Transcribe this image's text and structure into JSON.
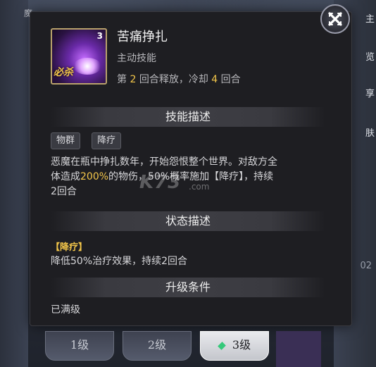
{
  "skill": {
    "name": "苦痛挣扎",
    "type": "主动技能",
    "level_badge": "3",
    "ult_label": "必杀",
    "timing_prefix": "第 ",
    "release_round": "2",
    "timing_mid": " 回合释放，冷却 ",
    "cooldown": "4",
    "timing_suffix": " 回合"
  },
  "sections": {
    "skill_desc_title": "技能描述",
    "status_desc_title": "状态描述",
    "upgrade_title": "升级条件"
  },
  "tags": [
    "物群",
    "降疗"
  ],
  "description": {
    "line1": "恶魔在瓶中挣扎数年，开始怨恨整个世界。对敌方全",
    "line2_a": "体造成",
    "line2_hl": "200%",
    "line2_b": "的物伤，50%概率施加【降疗】，持续",
    "line3": "2回合"
  },
  "status": {
    "name": "【降疗】",
    "text": "降低50%治疗效果，持续2回合"
  },
  "upgrade": {
    "text": "已满级"
  },
  "level_tabs": [
    "1级",
    "2级",
    "3级"
  ],
  "watermark": {
    "main": "K73",
    "sub": ".com"
  },
  "background": {
    "left_label": "魔",
    "right_items": [
      "主",
      "览",
      "享",
      "肤"
    ],
    "right_number": "02"
  },
  "colors": {
    "highlight": "#f3c64a",
    "panel": "#1e1e22"
  },
  "icons": {
    "close": "close-icon",
    "gem": "gem-icon"
  }
}
